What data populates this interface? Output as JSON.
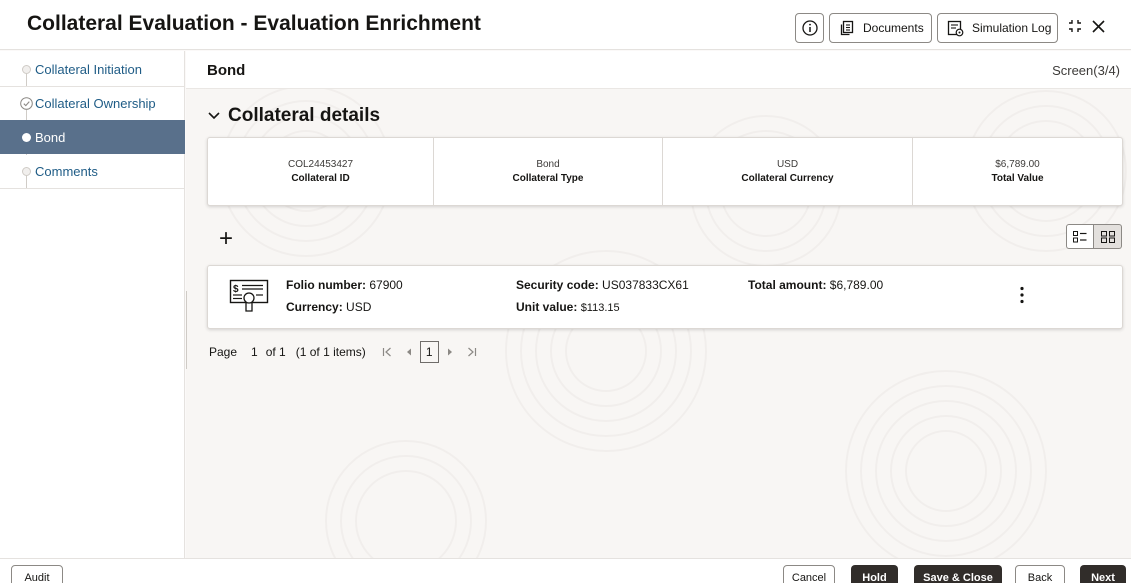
{
  "header": {
    "title": "Collateral Evaluation - Evaluation Enrichment",
    "documents_label": "Documents",
    "simulation_log_label": "Simulation Log"
  },
  "sidebar": {
    "items": [
      {
        "label": "Collateral Initiation",
        "state": "pending"
      },
      {
        "label": "Collateral Ownership",
        "state": "completed"
      },
      {
        "label": "Bond",
        "state": "active"
      },
      {
        "label": "Comments",
        "state": "pending"
      }
    ]
  },
  "main": {
    "section_name": "Bond",
    "screen_indicator": "Screen(3/4)",
    "collateral_details_title": "Collateral details",
    "summary": [
      {
        "value": "COL24453427",
        "label": "Collateral ID"
      },
      {
        "value": "Bond",
        "label": "Collateral Type"
      },
      {
        "value": "USD",
        "label": "Collateral Currency"
      },
      {
        "value": "$6,789.00",
        "label": "Total Value"
      }
    ],
    "add_symbol": "+",
    "card": {
      "folio_label": "Folio number:",
      "folio_value": "67900",
      "currency_label": "Currency:",
      "currency_value": "USD",
      "security_label": "Security code:",
      "security_value": "US037833CX61",
      "unit_label": "Unit value:",
      "unit_value": "$113.15",
      "total_label": "Total amount:",
      "total_value": "$6,789.00"
    },
    "pager": {
      "page_label": "Page",
      "page_value": "1",
      "of_text": "of 1",
      "items_text": "(1 of 1 items)",
      "current_page": "1"
    }
  },
  "footer": {
    "audit": "Audit",
    "cancel": "Cancel",
    "hold": "Hold",
    "save_close": "Save & Close",
    "back": "Back",
    "next": "Next"
  },
  "colors": {
    "active_nav": "#59708b",
    "link": "#1f5c86",
    "dark_button": "#312d2a"
  },
  "icons": [
    "info-icon",
    "documents-icon",
    "simulation-log-icon",
    "minimize-icon",
    "close-icon",
    "chevron-down-icon",
    "list-view-icon",
    "card-view-icon",
    "certificate-icon",
    "kebab-menu-icon"
  ]
}
